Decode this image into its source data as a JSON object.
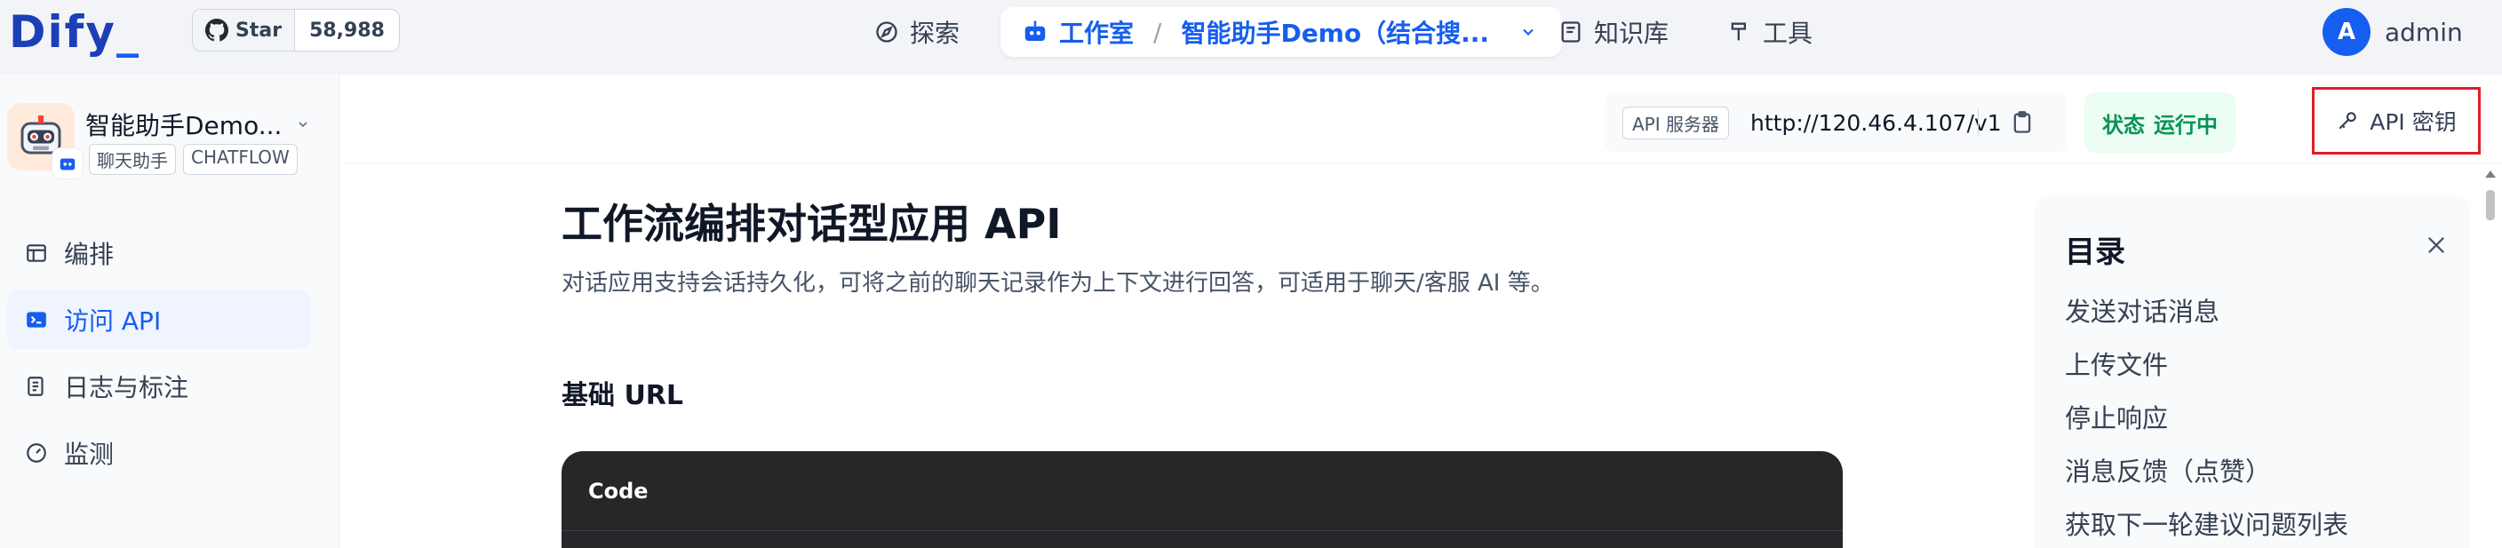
{
  "topbar": {
    "logo": "Dify",
    "github": {
      "label": "Star",
      "count": "58,988"
    },
    "nav": {
      "explore": "探索",
      "studio": "工作室",
      "app": "智能助手Demo（结合搜...",
      "knowledge": "知识库",
      "tools": "工具"
    },
    "user": {
      "initial": "A",
      "name": "admin"
    }
  },
  "sidebar": {
    "app_name": "智能助手Demo...",
    "tags": [
      "聊天助手",
      "CHATFLOW"
    ],
    "items": [
      {
        "label": "编排",
        "icon": "layout-icon"
      },
      {
        "label": "访问 API",
        "icon": "terminal-icon"
      },
      {
        "label": "日志与标注",
        "icon": "log-icon"
      },
      {
        "label": "监测",
        "icon": "gauge-icon"
      }
    ]
  },
  "toolbar": {
    "api_server_label": "API 服务器",
    "api_url": "http://120.46.4.107/v1",
    "status_label": "状态",
    "status_value": "运行中",
    "api_key_label": "API 密钥"
  },
  "doc": {
    "title": "工作流编排对话型应用 API",
    "desc": "对话应用支持会话持久化，可将之前的聊天记录作为上下文进行回答，可适用于聊天/客服 AI 等。",
    "section": "基础 URL",
    "code_label": "Code"
  },
  "toc": {
    "title": "目录",
    "items": [
      "发送对话消息",
      "上传文件",
      "停止响应",
      "消息反馈（点赞）",
      "获取下一轮建议问题列表"
    ]
  },
  "colors": {
    "primary": "#155eef",
    "success": "#079455",
    "highlight_border": "#e11d28",
    "code_bg": "#27272a"
  }
}
